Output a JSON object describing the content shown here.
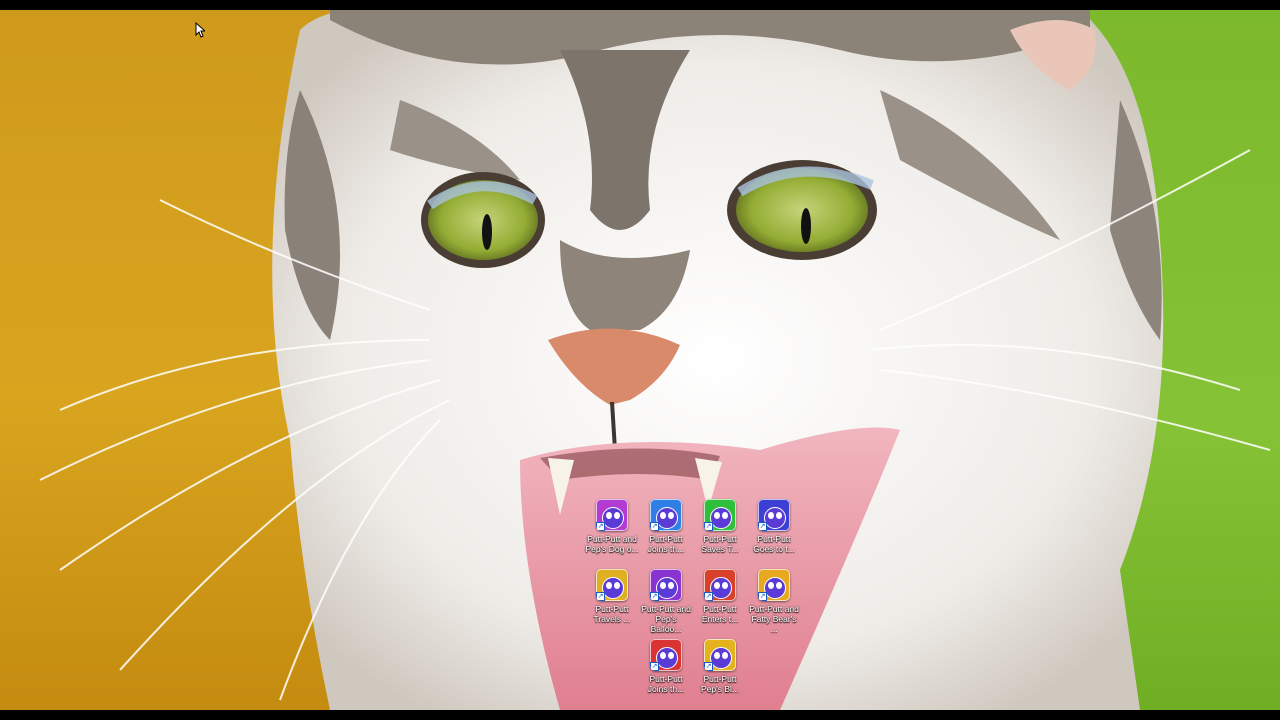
{
  "desktop": {
    "wallpaper_colors": {
      "left": "#d6a11c",
      "right": "#7cc22a",
      "fur": "#f2f0ed",
      "stripe": "#7a7068",
      "eye": "#9bb33a"
    },
    "icons": [
      {
        "label": "Putt-Putt and Pep's Dog o...",
        "icon": "putt-putt-dog-icon",
        "color": "#b23bd1"
      },
      {
        "label": "Putt-Putt Joins th...",
        "icon": "putt-putt-parade-icon",
        "color": "#2f7fe6"
      },
      {
        "label": "Putt-Putt Saves T...",
        "icon": "putt-putt-zoo-icon",
        "color": "#2fbf3a"
      },
      {
        "label": "Putt-Putt Goes to t...",
        "icon": "putt-putt-moon-icon",
        "color": "#3b3fd4"
      },
      {
        "label": "Putt-Putt Travels ...",
        "icon": "putt-putt-time-icon",
        "color": "#e0b020"
      },
      {
        "label": "Putt-Putt and Pep's Balloo...",
        "icon": "putt-putt-balloon-icon",
        "color": "#8a33d1"
      },
      {
        "label": "Putt-Putt Enters t...",
        "icon": "putt-putt-race-icon",
        "color": "#d8402a"
      },
      {
        "label": "Putt-Putt and Fatty Bear's ...",
        "icon": "putt-putt-fatty-bear-icon",
        "color": "#e8a820"
      },
      {
        "label": "Putt-Putt Joins th...",
        "icon": "putt-putt-circus-icon",
        "color": "#d93333"
      },
      {
        "label": "Putt-Putt Pep's Bl...",
        "icon": "putt-putt-pep-icon",
        "color": "#e3b21d"
      }
    ]
  }
}
